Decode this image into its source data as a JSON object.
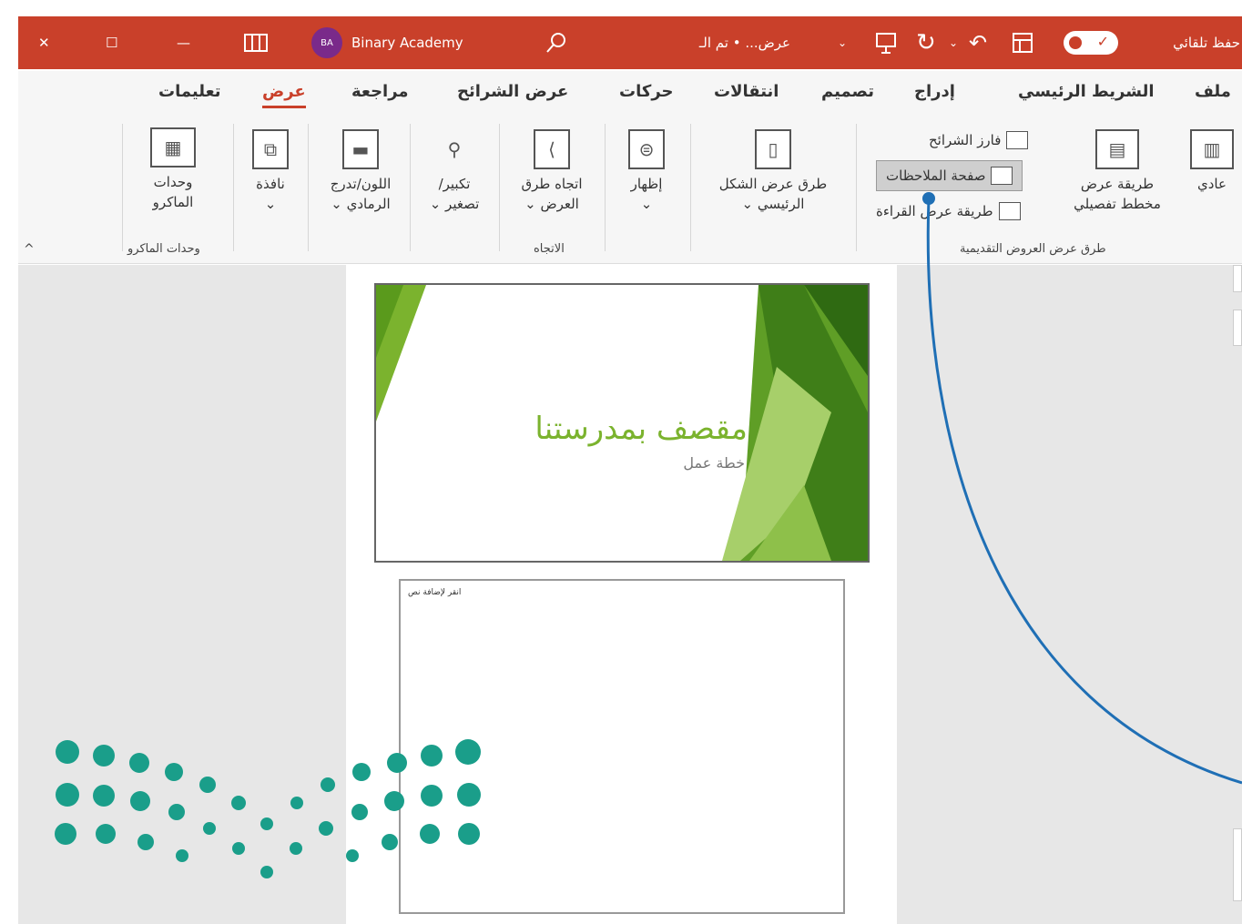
{
  "titlebar": {
    "close": "✕",
    "restore": "☐",
    "minimize": "—",
    "user_initials": "BA",
    "user_name": "Binary Academy",
    "doc_title": "عرض... • تم الـ",
    "autosave_label": "حفظ تلقائي",
    "autosave_on": true,
    "icons": [
      "close-icon",
      "restore-icon",
      "minimize-icon",
      "ribbon-display-icon",
      "search-icon",
      "present-icon",
      "undo-icon",
      "redo-icon",
      "customize-icon"
    ]
  },
  "tabs": [
    {
      "label": "ملف",
      "active": false
    },
    {
      "label": "الشريط الرئيسي",
      "active": false
    },
    {
      "label": "إدراج",
      "active": false
    },
    {
      "label": "تصميم",
      "active": false
    },
    {
      "label": "انتقالات",
      "active": false
    },
    {
      "label": "حركات",
      "active": false
    },
    {
      "label": "عرض الشرائح",
      "active": false
    },
    {
      "label": "مراجعة",
      "active": false
    },
    {
      "label": "عرض",
      "active": true
    },
    {
      "label": "تعليمات",
      "active": false
    }
  ],
  "ribbon": {
    "normal": "عادي",
    "outline_view_1": "طريقة عرض",
    "outline_view_2": "مخطط تفصيلي",
    "slide_sorter": "فارز الشرائح",
    "notes_page": "صفحة الملاحظات",
    "reading_view": "طريقة عرض القراءة",
    "group_presentation_views": "طرق عرض العروض التقديمية",
    "master_views_1": "طرق عرض الشكل",
    "master_views_2": "الرئيسي",
    "show": "إظهار",
    "orientation_1": "اتجاه طرق",
    "orientation_2": "العرض",
    "group_orientation": "الاتجاه",
    "zoom_1": "تكبير/",
    "zoom_2": "تصغير",
    "color_1": "اللون/تدرج",
    "color_2": "الرمادي",
    "window": "نافذة",
    "macros_1": "وحدات",
    "macros_2": "الماكرو",
    "group_macros": "وحدات الماكرو"
  },
  "slide": {
    "title": "مقصف بمدرستنا",
    "subtitle": "خطة عمل",
    "accent_color": "#7bb32e"
  },
  "notes_page": {
    "header_text": "انقر لإضافة نص"
  },
  "colors": {
    "titlebar": "#c9402a",
    "annotation_line": "#1f6fb5",
    "logo_teal": "#1a9e8a"
  }
}
